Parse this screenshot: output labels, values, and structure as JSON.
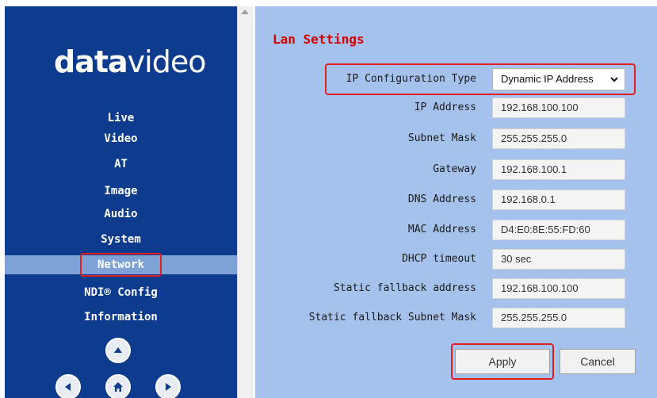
{
  "logo": {
    "part1": "data",
    "part2": "video"
  },
  "nav": [
    {
      "label": "Live"
    },
    {
      "label": "Video"
    },
    {
      "label": "AT"
    },
    {
      "label": "Image"
    },
    {
      "label": "Audio"
    },
    {
      "label": "System"
    },
    {
      "label": "Network",
      "active": true
    },
    {
      "label": "NDI® Config"
    },
    {
      "label": "Information"
    }
  ],
  "lan": {
    "title": "Lan Settings",
    "ip_config_label": "IP Configuration Type",
    "ip_config_value": "Dynamic IP Address",
    "fields": [
      {
        "label": "IP Address",
        "value": "192.168.100.100"
      },
      {
        "label": "Subnet Mask",
        "value": "255.255.255.0"
      },
      {
        "label": "Gateway",
        "value": "192.168.100.1"
      },
      {
        "label": "DNS Address",
        "value": "192.168.0.1"
      },
      {
        "label": "MAC Address",
        "value": "D4:E0:8E:55:FD:60"
      },
      {
        "label": "DHCP timeout",
        "value": "30 sec"
      },
      {
        "label": "Static fallback address",
        "value": "192.168.100.100"
      },
      {
        "label": "Static fallback Subnet Mask",
        "value": "255.255.255.0"
      }
    ]
  },
  "buttons": {
    "apply": "Apply",
    "cancel": "Cancel"
  },
  "icons": {
    "up": "arrow-up-icon",
    "left": "arrow-left-icon",
    "home": "home-icon",
    "right": "arrow-right-icon"
  },
  "colors": {
    "sidebar": "#0d3b8e",
    "active_nav": "#7fa2d6",
    "main_bg": "#a5c2ec",
    "highlight": "#e02020",
    "title": "#d40000"
  }
}
